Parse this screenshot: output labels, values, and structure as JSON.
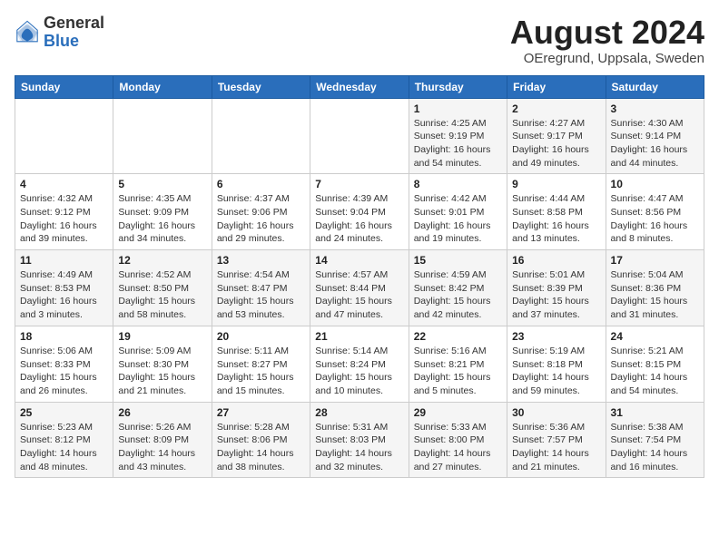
{
  "header": {
    "logo_general": "General",
    "logo_blue": "Blue",
    "title": "August 2024",
    "subtitle": "OEregrund, Uppsala, Sweden"
  },
  "weekdays": [
    "Sunday",
    "Monday",
    "Tuesday",
    "Wednesday",
    "Thursday",
    "Friday",
    "Saturday"
  ],
  "weeks": [
    [
      {
        "day": "",
        "info": ""
      },
      {
        "day": "",
        "info": ""
      },
      {
        "day": "",
        "info": ""
      },
      {
        "day": "",
        "info": ""
      },
      {
        "day": "1",
        "info": "Sunrise: 4:25 AM\nSunset: 9:19 PM\nDaylight: 16 hours\nand 54 minutes."
      },
      {
        "day": "2",
        "info": "Sunrise: 4:27 AM\nSunset: 9:17 PM\nDaylight: 16 hours\nand 49 minutes."
      },
      {
        "day": "3",
        "info": "Sunrise: 4:30 AM\nSunset: 9:14 PM\nDaylight: 16 hours\nand 44 minutes."
      }
    ],
    [
      {
        "day": "4",
        "info": "Sunrise: 4:32 AM\nSunset: 9:12 PM\nDaylight: 16 hours\nand 39 minutes."
      },
      {
        "day": "5",
        "info": "Sunrise: 4:35 AM\nSunset: 9:09 PM\nDaylight: 16 hours\nand 34 minutes."
      },
      {
        "day": "6",
        "info": "Sunrise: 4:37 AM\nSunset: 9:06 PM\nDaylight: 16 hours\nand 29 minutes."
      },
      {
        "day": "7",
        "info": "Sunrise: 4:39 AM\nSunset: 9:04 PM\nDaylight: 16 hours\nand 24 minutes."
      },
      {
        "day": "8",
        "info": "Sunrise: 4:42 AM\nSunset: 9:01 PM\nDaylight: 16 hours\nand 19 minutes."
      },
      {
        "day": "9",
        "info": "Sunrise: 4:44 AM\nSunset: 8:58 PM\nDaylight: 16 hours\nand 13 minutes."
      },
      {
        "day": "10",
        "info": "Sunrise: 4:47 AM\nSunset: 8:56 PM\nDaylight: 16 hours\nand 8 minutes."
      }
    ],
    [
      {
        "day": "11",
        "info": "Sunrise: 4:49 AM\nSunset: 8:53 PM\nDaylight: 16 hours\nand 3 minutes."
      },
      {
        "day": "12",
        "info": "Sunrise: 4:52 AM\nSunset: 8:50 PM\nDaylight: 15 hours\nand 58 minutes."
      },
      {
        "day": "13",
        "info": "Sunrise: 4:54 AM\nSunset: 8:47 PM\nDaylight: 15 hours\nand 53 minutes."
      },
      {
        "day": "14",
        "info": "Sunrise: 4:57 AM\nSunset: 8:44 PM\nDaylight: 15 hours\nand 47 minutes."
      },
      {
        "day": "15",
        "info": "Sunrise: 4:59 AM\nSunset: 8:42 PM\nDaylight: 15 hours\nand 42 minutes."
      },
      {
        "day": "16",
        "info": "Sunrise: 5:01 AM\nSunset: 8:39 PM\nDaylight: 15 hours\nand 37 minutes."
      },
      {
        "day": "17",
        "info": "Sunrise: 5:04 AM\nSunset: 8:36 PM\nDaylight: 15 hours\nand 31 minutes."
      }
    ],
    [
      {
        "day": "18",
        "info": "Sunrise: 5:06 AM\nSunset: 8:33 PM\nDaylight: 15 hours\nand 26 minutes."
      },
      {
        "day": "19",
        "info": "Sunrise: 5:09 AM\nSunset: 8:30 PM\nDaylight: 15 hours\nand 21 minutes."
      },
      {
        "day": "20",
        "info": "Sunrise: 5:11 AM\nSunset: 8:27 PM\nDaylight: 15 hours\nand 15 minutes."
      },
      {
        "day": "21",
        "info": "Sunrise: 5:14 AM\nSunset: 8:24 PM\nDaylight: 15 hours\nand 10 minutes."
      },
      {
        "day": "22",
        "info": "Sunrise: 5:16 AM\nSunset: 8:21 PM\nDaylight: 15 hours\nand 5 minutes."
      },
      {
        "day": "23",
        "info": "Sunrise: 5:19 AM\nSunset: 8:18 PM\nDaylight: 14 hours\nand 59 minutes."
      },
      {
        "day": "24",
        "info": "Sunrise: 5:21 AM\nSunset: 8:15 PM\nDaylight: 14 hours\nand 54 minutes."
      }
    ],
    [
      {
        "day": "25",
        "info": "Sunrise: 5:23 AM\nSunset: 8:12 PM\nDaylight: 14 hours\nand 48 minutes."
      },
      {
        "day": "26",
        "info": "Sunrise: 5:26 AM\nSunset: 8:09 PM\nDaylight: 14 hours\nand 43 minutes."
      },
      {
        "day": "27",
        "info": "Sunrise: 5:28 AM\nSunset: 8:06 PM\nDaylight: 14 hours\nand 38 minutes."
      },
      {
        "day": "28",
        "info": "Sunrise: 5:31 AM\nSunset: 8:03 PM\nDaylight: 14 hours\nand 32 minutes."
      },
      {
        "day": "29",
        "info": "Sunrise: 5:33 AM\nSunset: 8:00 PM\nDaylight: 14 hours\nand 27 minutes."
      },
      {
        "day": "30",
        "info": "Sunrise: 5:36 AM\nSunset: 7:57 PM\nDaylight: 14 hours\nand 21 minutes."
      },
      {
        "day": "31",
        "info": "Sunrise: 5:38 AM\nSunset: 7:54 PM\nDaylight: 14 hours\nand 16 minutes."
      }
    ]
  ]
}
